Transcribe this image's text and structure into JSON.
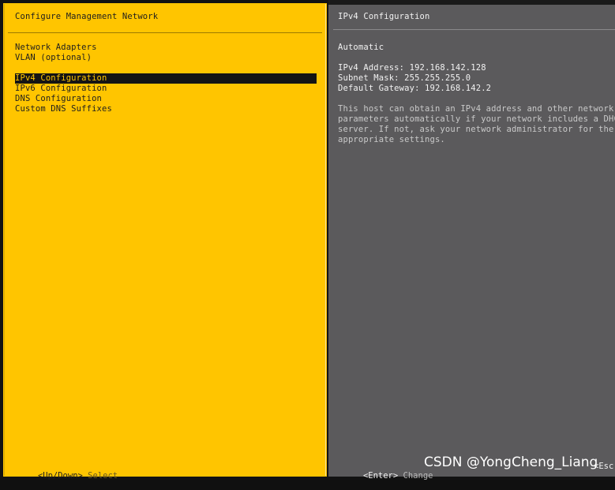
{
  "left_pane": {
    "title": "Configure Management Network",
    "menu_items": [
      {
        "label": "Network Adapters"
      },
      {
        "label": "VLAN (optional)"
      },
      {
        "label": "IPv4 Configuration",
        "selected": true
      },
      {
        "label": "IPv6 Configuration"
      },
      {
        "label": "DNS Configuration"
      },
      {
        "label": "Custom DNS Suffixes"
      }
    ],
    "footer_key": "<Up/Down>",
    "footer_action": "Select"
  },
  "right_pane": {
    "title": "IPv4 Configuration",
    "mode": "Automatic",
    "ipv4_address": "IPv4 Address: 192.168.142.128",
    "subnet_mask": "Subnet Mask: 255.255.255.0",
    "default_gateway": "Default Gateway: 192.168.142.2",
    "description_lines": [
      "This host can obtain an IPv4 address and other network",
      "parameters automatically if your network includes a DHC",
      "server. If not, ask your network administrator for the",
      "appropriate settings."
    ],
    "footer_key": "<Enter>",
    "footer_action": "Change",
    "footer_edge": "<Esc"
  },
  "watermark": "CSDN @YongCheng_Liang",
  "colors": {
    "left_pane_bg": "#ffc500",
    "right_pane_bg": "#5b5a5c",
    "highlight_bg": "#141414"
  }
}
